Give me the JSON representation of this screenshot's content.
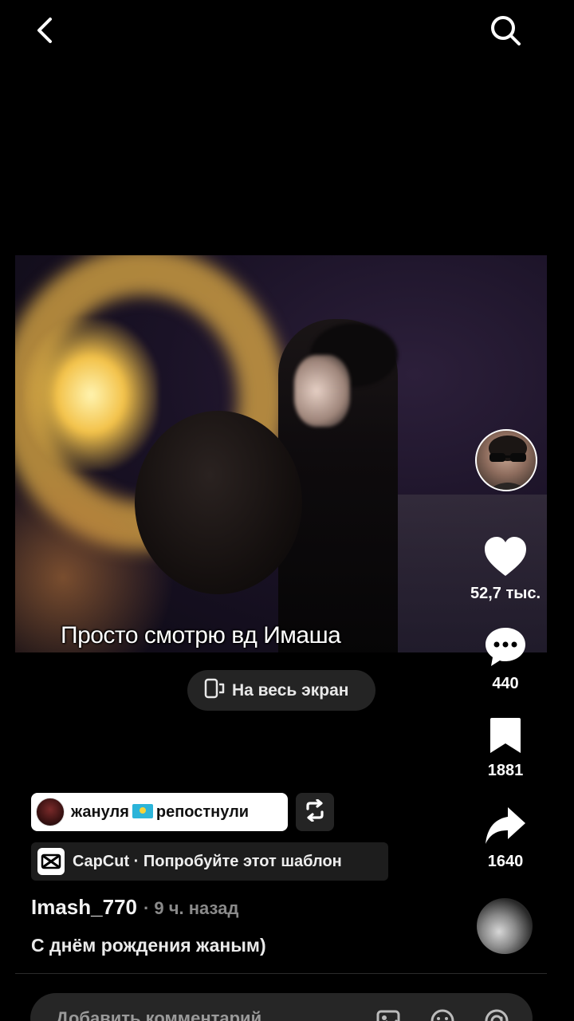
{
  "header": {
    "back_icon": "chevron-left-icon",
    "search_icon": "search-icon"
  },
  "video": {
    "caption": "Просто смотрю вд Имаша",
    "fullscreen_label": "На весь экран"
  },
  "actions": {
    "likes": "52,7 тыс.",
    "comments": "440",
    "saves": "1881",
    "shares": "1640"
  },
  "repost": {
    "user": "жануля",
    "suffix": "репостнули"
  },
  "template": {
    "label": "CapCut · Попробуйте этот шаблон"
  },
  "post": {
    "author": "Imash_770",
    "time": "· 9 ч. назад",
    "description": "С днём рождения жаным)"
  },
  "comment_bar": {
    "placeholder": "Добавить комментарий..."
  },
  "colors": {
    "background": "#000000",
    "pill_dark": "#262626",
    "accent_white": "#ffffff"
  }
}
